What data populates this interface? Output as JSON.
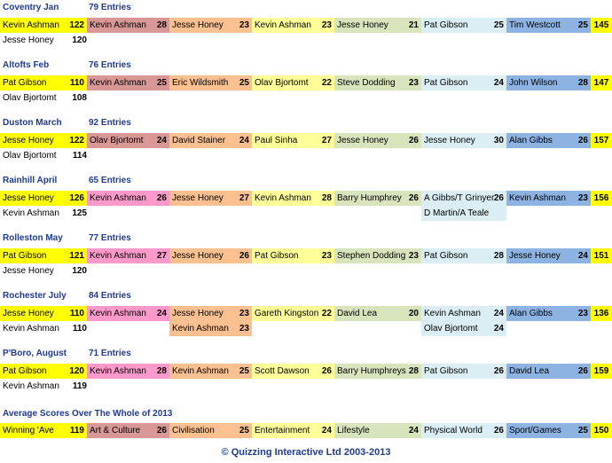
{
  "colors": {
    "winner": "#ffff00",
    "c1": "#d99795",
    "c2": "#fac090",
    "c3": "#ffff99",
    "c4": "#d7e4bc",
    "c5": "#daeef3",
    "c6": "#8db3e2",
    "total": "#ffff00",
    "pink": "#ff99cc",
    "lightgreen": "#ccffcc",
    "culture": "#d99795",
    "civ": "#fac090",
    "ent": "#ffff99",
    "life": "#d7e4bc",
    "phys": "#daeef3",
    "sport": "#8db3e2"
  },
  "events": [
    {
      "title": "Coventry Jan",
      "entries": "79 Entries",
      "winner": {
        "name": "Kevin Ashman",
        "score": "122"
      },
      "cells": [
        {
          "name": "Kevin Ashman",
          "score": "28"
        },
        {
          "name": "Jesse Honey",
          "score": "23"
        },
        {
          "name": "Kevin Ashman",
          "score": "23"
        },
        {
          "name": "Jesse Honey",
          "score": "21"
        },
        {
          "name": "Pat Gibson",
          "score": "25"
        },
        {
          "name": "Tim Westcott",
          "score": "25"
        }
      ],
      "total": "145",
      "runner": {
        "name": "Jesse Honey",
        "score": "120"
      },
      "extra": []
    },
    {
      "title": "Altofts Feb",
      "entries": "76 Entries",
      "winner": {
        "name": "Pat Gibson",
        "score": "110"
      },
      "cells": [
        {
          "name": "Kevin Ashman",
          "score": "25"
        },
        {
          "name": "Eric Wildsmith",
          "score": "25"
        },
        {
          "name": "Olav Bjortomt",
          "score": "22"
        },
        {
          "name": "Steve Dodding",
          "score": "23"
        },
        {
          "name": "Pat Gibson",
          "score": "24"
        },
        {
          "name": "John Wilson",
          "score": "28"
        }
      ],
      "total": "147",
      "runner": {
        "name": "Olav Bjortomt",
        "score": "108"
      },
      "extra": []
    },
    {
      "title": "Duston March",
      "entries": "92 Entries",
      "winner": {
        "name": "Jesse Honey",
        "score": "122"
      },
      "cells": [
        {
          "name": "Olav Bjortomt",
          "score": "24"
        },
        {
          "name": "David Stainer",
          "score": "24"
        },
        {
          "name": "Paul Sinha",
          "score": "27"
        },
        {
          "name": "Jesse Honey",
          "score": "26"
        },
        {
          "name": "Jesse Honey",
          "score": "30"
        },
        {
          "name": "Alan Gibbs",
          "score": "26"
        }
      ],
      "total": "157",
      "runner": {
        "name": "Olav Bjortomt",
        "score": "114"
      },
      "extra": []
    },
    {
      "title": "Rainhill April",
      "entries": "65 Entries",
      "winner": {
        "name": "Jesse Honey",
        "score": "126"
      },
      "cells": [
        {
          "name": "Kevin Ashman",
          "score": "26"
        },
        {
          "name": "Jesse Honey",
          "score": "27"
        },
        {
          "name": "Kevin Ashman",
          "score": "28"
        },
        {
          "name": "Barry Humphrey",
          "score": "26"
        },
        {
          "name": "A Gibbs/T Grinyer",
          "score": "26"
        },
        {
          "name": "Kevin Ashman",
          "score": "23"
        }
      ],
      "total": "156",
      "runner": {
        "name": "Kevin Ashman",
        "score": "125"
      },
      "extra": [
        {
          "col": 4,
          "name": "D Martin/A Teale",
          "score": ""
        }
      ]
    },
    {
      "title": "Rolleston May",
      "entries": "77 Entries",
      "winner": {
        "name": "Pat Gibson",
        "score": "121"
      },
      "cells": [
        {
          "name": "Kevin Ashman",
          "score": "27"
        },
        {
          "name": "Jesse Honey",
          "score": "26"
        },
        {
          "name": "Pat Gibson",
          "score": "23"
        },
        {
          "name": "Stephen Dodding",
          "score": "23"
        },
        {
          "name": "Pat Gibson",
          "score": "28"
        },
        {
          "name": "Jesse Honey",
          "score": "24"
        }
      ],
      "total": "151",
      "runner": {
        "name": "Jesse Honey",
        "score": "120"
      },
      "extra": []
    },
    {
      "title": "Rochester July",
      "entries": "84 Entries",
      "winner": {
        "name": "Jesse Honey",
        "score": "110"
      },
      "cells": [
        {
          "name": "Kevin Ashman",
          "score": "24"
        },
        {
          "name": "Jesse Honey",
          "score": "23"
        },
        {
          "name": "Gareth Kingston",
          "score": "22"
        },
        {
          "name": "David Lea",
          "score": "20"
        },
        {
          "name": "Kevin Ashman",
          "score": "24"
        },
        {
          "name": "Alan Gibbs",
          "score": "23"
        }
      ],
      "total": "136",
      "runner": {
        "name": "Kevin Ashman",
        "score": "110"
      },
      "extra": [
        {
          "col": 1,
          "name": "Kevin Ashman",
          "score": "23"
        },
        {
          "col": 4,
          "name": "Olav Bjortomt",
          "score": "24"
        }
      ]
    },
    {
      "title": "P'Boro, August",
      "entries": "71 Entries",
      "winner": {
        "name": "Pat Gibson",
        "score": "120"
      },
      "cells": [
        {
          "name": "Kevin Ashman",
          "score": "28"
        },
        {
          "name": "Kevin Ashman",
          "score": "25"
        },
        {
          "name": "Scott Dawson",
          "score": "26"
        },
        {
          "name": "Barry Humphreys",
          "score": "28"
        },
        {
          "name": "Pat Gibson",
          "score": "26"
        },
        {
          "name": "David Lea",
          "score": "26"
        }
      ],
      "total": "159",
      "runner": {
        "name": "Kevin Ashman",
        "score": "119"
      },
      "extra": []
    }
  ],
  "average": {
    "title": "Average Scores Over The Whole of 2013",
    "winner": {
      "name": "Winning 'Ave",
      "score": "119"
    },
    "cells": [
      {
        "name": "Art & Culture",
        "score": "26"
      },
      {
        "name": "Civilisation",
        "score": "25"
      },
      {
        "name": "Entertainment",
        "score": "24"
      },
      {
        "name": "Lifestyle",
        "score": "24"
      },
      {
        "name": "Physical World",
        "score": "26"
      },
      {
        "name": "Sport/Games",
        "score": "25"
      }
    ],
    "total": "150"
  },
  "footer": "© Quizzing Interactive Ltd 2003-2013"
}
